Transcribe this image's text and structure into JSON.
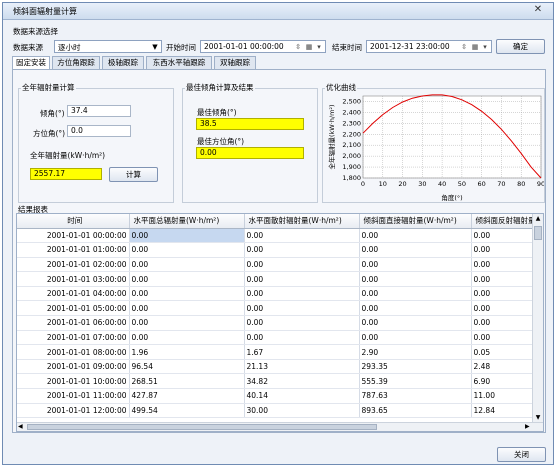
{
  "window": {
    "title": "倾斜面辐射量计算",
    "close_glyph": "✕"
  },
  "source": {
    "group_label": "数据来源选择",
    "source_label": "数据来源",
    "source_value": "逐小时",
    "start_label": "开始时间",
    "start_value": "2001-01-01  00:00:00",
    "end_label": "结束时间",
    "end_value": "2001-12-31  23:00:00",
    "confirm_label": "确定"
  },
  "tabs": [
    "固定安装",
    "方位角跟踪",
    "极轴跟踪",
    "东西水平轴跟踪",
    "双轴跟踪"
  ],
  "annual": {
    "group_label": "全年辐射量计算",
    "tilt_label": "倾角(°)",
    "tilt_value": "37.4",
    "azimuth_label": "方位角(°)",
    "azimuth_value": "0.0",
    "total_label": "全年辐射量(kW·h/m²)",
    "total_value": "2557.17",
    "calc_label": "计算"
  },
  "best": {
    "group_label": "最佳倾角计算及结果",
    "tilt_label": "最佳倾角(°)",
    "tilt_value": "38.5",
    "azimuth_label": "最佳方位角(°)",
    "azimuth_value": "0.00"
  },
  "curve": {
    "group_label": "优化曲线"
  },
  "chart_data": {
    "type": "line",
    "title": "",
    "xlabel": "角度(°)",
    "ylabel": "全年辐射量(kW·h/m²)",
    "xlim": [
      0,
      90
    ],
    "ylim": [
      1800,
      2550
    ],
    "xticks": [
      "0",
      "10",
      "20",
      "30",
      "40",
      "50",
      "60",
      "70",
      "80",
      "90"
    ],
    "yticks": [
      "1,800",
      "1,900",
      "2,000",
      "2,100",
      "2,200",
      "2,300",
      "2,400",
      "2,500"
    ],
    "grid": true,
    "line_color": "#e00000",
    "x": [
      0,
      5,
      10,
      15,
      20,
      25,
      30,
      35,
      40,
      45,
      50,
      55,
      60,
      65,
      70,
      75,
      80,
      85,
      90
    ],
    "y": [
      2210,
      2300,
      2380,
      2445,
      2495,
      2530,
      2550,
      2560,
      2560,
      2545,
      2515,
      2470,
      2410,
      2335,
      2245,
      2140,
      2025,
      1900,
      1770
    ]
  },
  "results": {
    "group_label": "结果报表",
    "columns": [
      "时间",
      "水平面总辐射量(W·h/m²)",
      "水平面散射辐射量(W·h/m²)",
      "倾斜面直接辐射量(W·h/m²)",
      "倾斜面反射辐射量"
    ],
    "rows": [
      [
        "2001-01-01 00:00:00",
        "0.00",
        "0.00",
        "0.00",
        "0.00"
      ],
      [
        "2001-01-01 01:00:00",
        "0.00",
        "0.00",
        "0.00",
        "0.00"
      ],
      [
        "2001-01-01 02:00:00",
        "0.00",
        "0.00",
        "0.00",
        "0.00"
      ],
      [
        "2001-01-01 03:00:00",
        "0.00",
        "0.00",
        "0.00",
        "0.00"
      ],
      [
        "2001-01-01 04:00:00",
        "0.00",
        "0.00",
        "0.00",
        "0.00"
      ],
      [
        "2001-01-01 05:00:00",
        "0.00",
        "0.00",
        "0.00",
        "0.00"
      ],
      [
        "2001-01-01 06:00:00",
        "0.00",
        "0.00",
        "0.00",
        "0.00"
      ],
      [
        "2001-01-01 07:00:00",
        "0.00",
        "0.00",
        "0.00",
        "0.00"
      ],
      [
        "2001-01-01 08:00:00",
        "1.96",
        "1.67",
        "2.90",
        "0.05"
      ],
      [
        "2001-01-01 09:00:00",
        "96.54",
        "21.13",
        "293.35",
        "2.48"
      ],
      [
        "2001-01-01 10:00:00",
        "268.51",
        "34.82",
        "555.39",
        "6.90"
      ],
      [
        "2001-01-01 11:00:00",
        "427.87",
        "40.14",
        "787.63",
        "11.00"
      ],
      [
        "2001-01-01 12:00:00",
        "499.54",
        "30.00",
        "893.65",
        "12.84"
      ]
    ]
  },
  "footer": {
    "close_label": "关闭"
  }
}
